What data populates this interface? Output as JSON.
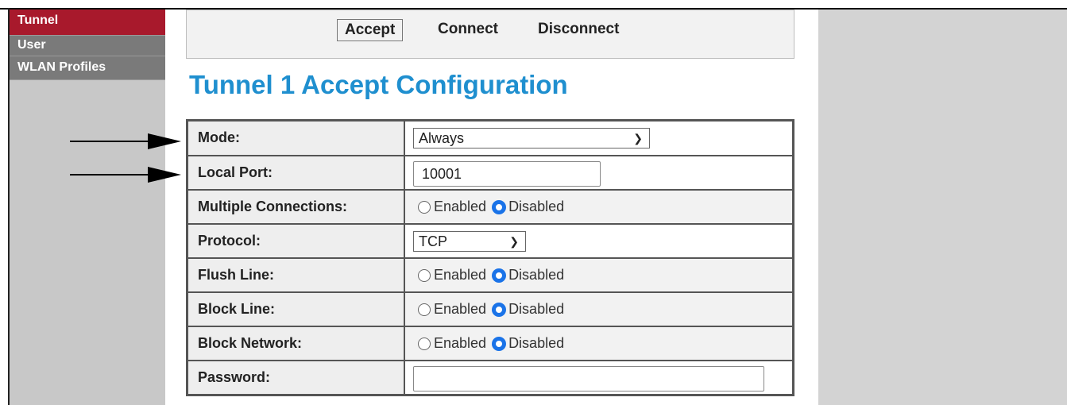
{
  "sidebar": {
    "items": [
      {
        "label": "Tunnel",
        "active": true
      },
      {
        "label": "User"
      },
      {
        "label": "WLAN Profiles"
      }
    ]
  },
  "tabs": {
    "accept": "Accept",
    "connect": "Connect",
    "disconnect": "Disconnect",
    "active": "Accept"
  },
  "page": {
    "title": "Tunnel 1 Accept Configuration"
  },
  "form": {
    "mode": {
      "label": "Mode:",
      "value": "Always"
    },
    "local_port": {
      "label": "Local Port:",
      "value": "10001"
    },
    "multiple_connections": {
      "label": "Multiple Connections:",
      "options": [
        "Enabled",
        "Disabled"
      ],
      "selected": "Disabled"
    },
    "protocol": {
      "label": "Protocol:",
      "value": "TCP"
    },
    "flush_line": {
      "label": "Flush Line:",
      "options": [
        "Enabled",
        "Disabled"
      ],
      "selected": "Disabled"
    },
    "block_line": {
      "label": "Block Line:",
      "options": [
        "Enabled",
        "Disabled"
      ],
      "selected": "Disabled"
    },
    "block_network": {
      "label": "Block Network:",
      "options": [
        "Enabled",
        "Disabled"
      ],
      "selected": "Disabled"
    },
    "password": {
      "label": "Password:",
      "value": ""
    }
  },
  "colors": {
    "active_tab_red": "#a8192c",
    "title_blue": "#1f8fcf",
    "radio_blue": "#1a73e8"
  },
  "icons": {
    "select_arrow": "chevron-down-icon",
    "annotation": "arrow-right-icon"
  }
}
